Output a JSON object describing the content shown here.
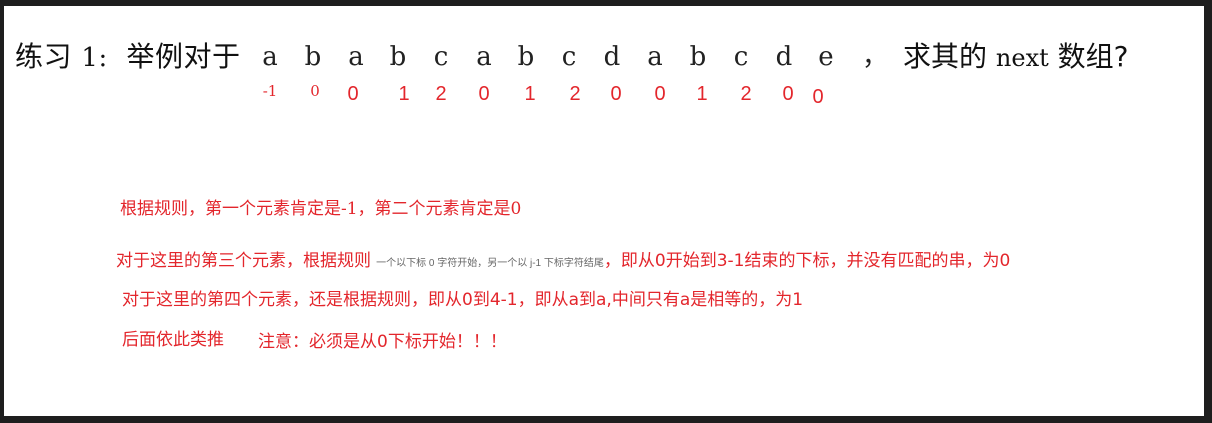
{
  "question": {
    "prefix_text": "练习",
    "number": "1:",
    "middle_text": "举例对于",
    "pattern": [
      "a",
      "b",
      "a",
      "b",
      "c",
      "a",
      "b",
      "c",
      "d",
      "a",
      "b",
      "c",
      "d",
      "e"
    ],
    "comma": "，",
    "suffix_before": "求其的",
    "suffix_keyword": "next",
    "suffix_after": "数组?"
  },
  "next_values": [
    "-1",
    "0",
    "0",
    "1",
    "2",
    "0",
    "1",
    "2",
    "0",
    "0",
    "1",
    "2",
    "0",
    "0"
  ],
  "notes": {
    "rule_first_two": "根据规则，第一个元素肯定是-1，第二个元素肯定是0",
    "third_prefix": "对于这里的第三个元素，根据规则",
    "third_small": "一个以下标 0 字符开始，另一个以 j-1 下标字符结尾",
    "third_suffix": "，即从0开始到3-1结束的下标，并没有匹配的串，为0",
    "fourth": "对于这里的第四个元素，还是根据规则，即从0到4-1，即从a到a,中间只有a是相等的，为1",
    "and_so_on": "后面依此类推",
    "attention": "注意：必须是从0下标开始！！！"
  },
  "colors": {
    "accent_red": "#e3262c",
    "text_dark": "#111111",
    "background_frame": "#1e1e1e",
    "page": "#ffffff"
  }
}
